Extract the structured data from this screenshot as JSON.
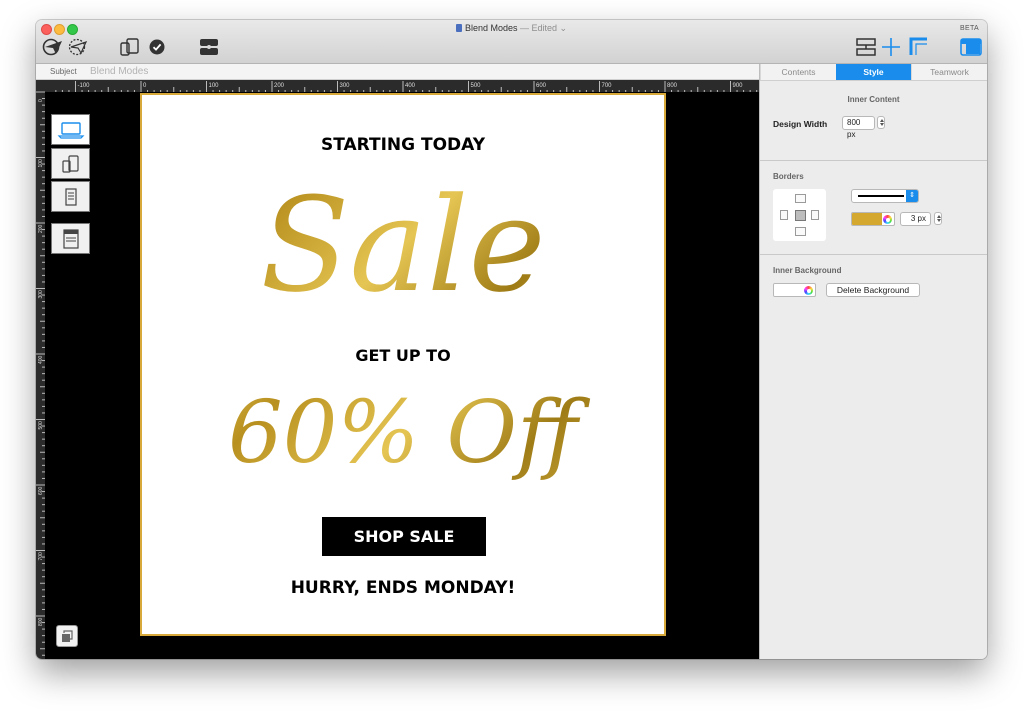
{
  "window": {
    "title": "Blend Modes",
    "status": "— Edited ⌄",
    "badge": "BETA"
  },
  "toolbar": {
    "icons": [
      "send-icon",
      "test-send-icon",
      "devices-icon",
      "check-icon",
      "preview-icon",
      "layout-icon",
      "move-icon",
      "ruler-icon",
      "sidebar-icon"
    ]
  },
  "subject": {
    "label": "Subject",
    "value": "Blend Modes"
  },
  "ruler": {
    "h_labels": [
      "-100",
      "0",
      "100",
      "200",
      "300",
      "400",
      "500",
      "600",
      "700",
      "800",
      "900"
    ],
    "v_labels": [
      "0",
      "100",
      "200",
      "300",
      "400",
      "500",
      "600",
      "700",
      "800"
    ]
  },
  "canvas": {
    "view_modes": [
      "desktop-view-icon",
      "mobile-view-icon",
      "text-view-icon",
      "source-view-icon"
    ],
    "selected_view": "desktop-view-icon"
  },
  "design": {
    "line1": "STARTING TODAY",
    "sale": "Sale",
    "line2": "GET UP TO",
    "discount": "60% Off",
    "cta": "SHOP SALE",
    "footer": "HURRY, ENDS MONDAY!",
    "gold_color": "#c9a227",
    "frame_color": "#d6a93a"
  },
  "panel": {
    "tabs": [
      "Contents",
      "Style",
      "Teamwork"
    ],
    "active_tab": "Style",
    "inner_content": {
      "title": "Inner Content",
      "design_width_label": "Design Width",
      "design_width_value": "800 px"
    },
    "borders": {
      "title": "Borders",
      "color": "#d4a82e",
      "width_value": "3 px"
    },
    "inner_background": {
      "title": "Inner Background",
      "delete_label": "Delete Background"
    }
  },
  "colors": {
    "accent": "#1a8dec",
    "canvas_bg": "#000000"
  }
}
